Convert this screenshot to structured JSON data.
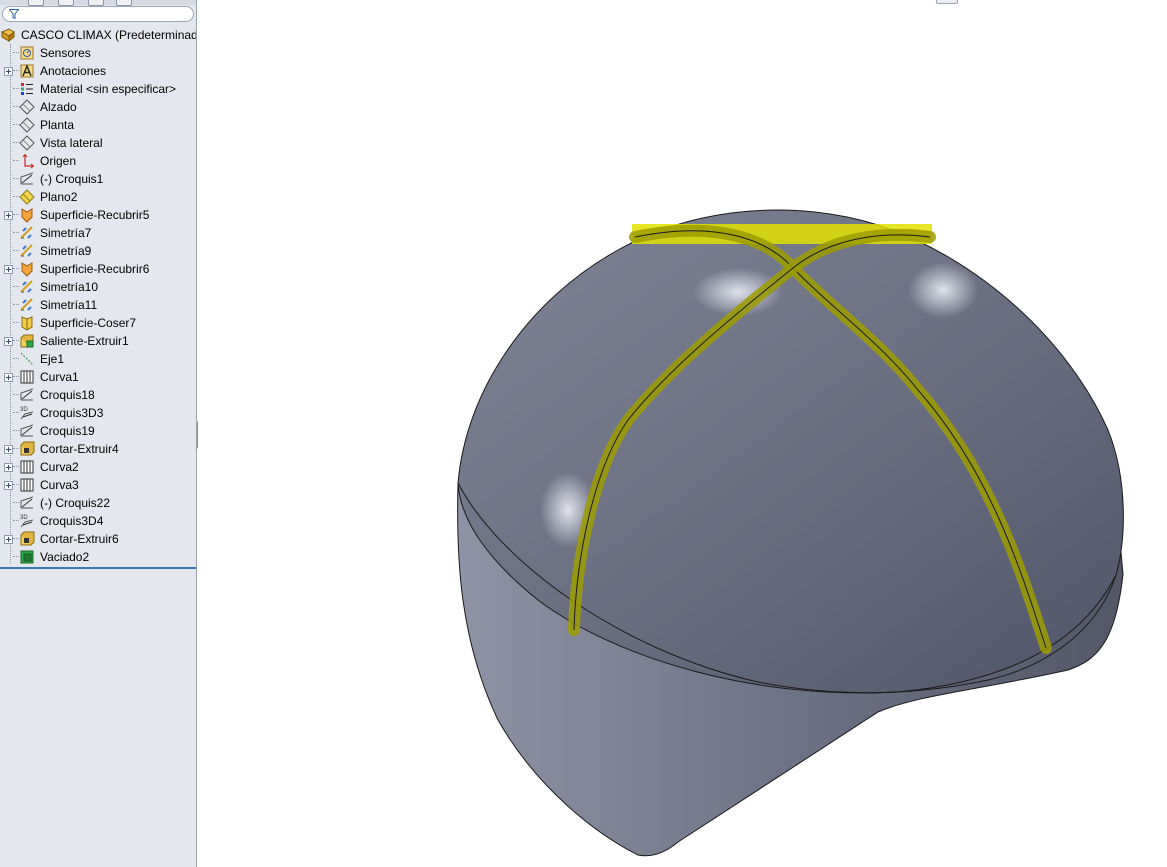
{
  "feature_tree": {
    "root": {
      "label": "CASCO CLIMAX  (Predeterminado",
      "icon": "part-icon"
    },
    "items": [
      {
        "label": "Sensores",
        "icon": "sensor-icon",
        "expandable": false
      },
      {
        "label": "Anotaciones",
        "icon": "annotations-icon",
        "expandable": true
      },
      {
        "label": "Material <sin especificar>",
        "icon": "material-icon",
        "expandable": false
      },
      {
        "label": "Alzado",
        "icon": "plane-icon",
        "expandable": false
      },
      {
        "label": "Planta",
        "icon": "plane-icon",
        "expandable": false
      },
      {
        "label": "Vista lateral",
        "icon": "plane-icon",
        "expandable": false
      },
      {
        "label": "Origen",
        "icon": "origin-icon",
        "expandable": false
      },
      {
        "label": "(-) Croquis1",
        "icon": "sketch-icon",
        "expandable": false
      },
      {
        "label": "Plano2",
        "icon": "plane-yellow-icon",
        "expandable": false
      },
      {
        "label": "Superficie-Recubrir5",
        "icon": "surface-loft-icon",
        "expandable": true
      },
      {
        "label": "Simetría7",
        "icon": "mirror-icon",
        "expandable": false
      },
      {
        "label": "Simetría9",
        "icon": "mirror-icon",
        "expandable": false
      },
      {
        "label": "Superficie-Recubrir6",
        "icon": "surface-loft-icon",
        "expandable": true
      },
      {
        "label": "Simetría10",
        "icon": "mirror-icon",
        "expandable": false
      },
      {
        "label": "Simetría11",
        "icon": "mirror-icon",
        "expandable": false
      },
      {
        "label": "Superficie-Coser7",
        "icon": "knit-icon",
        "expandable": false
      },
      {
        "label": "Saliente-Extruir1",
        "icon": "extrude-icon",
        "expandable": true
      },
      {
        "label": "Eje1",
        "icon": "axis-icon",
        "expandable": false
      },
      {
        "label": "Curva1",
        "icon": "curve-icon",
        "expandable": true
      },
      {
        "label": "Croquis18",
        "icon": "sketch-icon",
        "expandable": false
      },
      {
        "label": "Croquis3D3",
        "icon": "sketch3d-icon",
        "expandable": false
      },
      {
        "label": "Croquis19",
        "icon": "sketch-icon",
        "expandable": false
      },
      {
        "label": "Cortar-Extruir4",
        "icon": "cut-extrude-icon",
        "expandable": true
      },
      {
        "label": "Curva2",
        "icon": "curve-icon",
        "expandable": true
      },
      {
        "label": "Curva3",
        "icon": "curve-icon",
        "expandable": true
      },
      {
        "label": "(-) Croquis22",
        "icon": "sketch-icon",
        "expandable": false
      },
      {
        "label": "Croquis3D4",
        "icon": "sketch3d-icon",
        "expandable": false
      },
      {
        "label": "Cortar-Extruir6",
        "icon": "cut-extrude-icon",
        "expandable": true
      },
      {
        "label": "Vaciado2",
        "icon": "shell-icon",
        "expandable": false
      }
    ]
  },
  "colors": {
    "sidebar_bg": "#e4e7ed",
    "model_body": "#6f7386",
    "highlight": "#c8c800"
  }
}
